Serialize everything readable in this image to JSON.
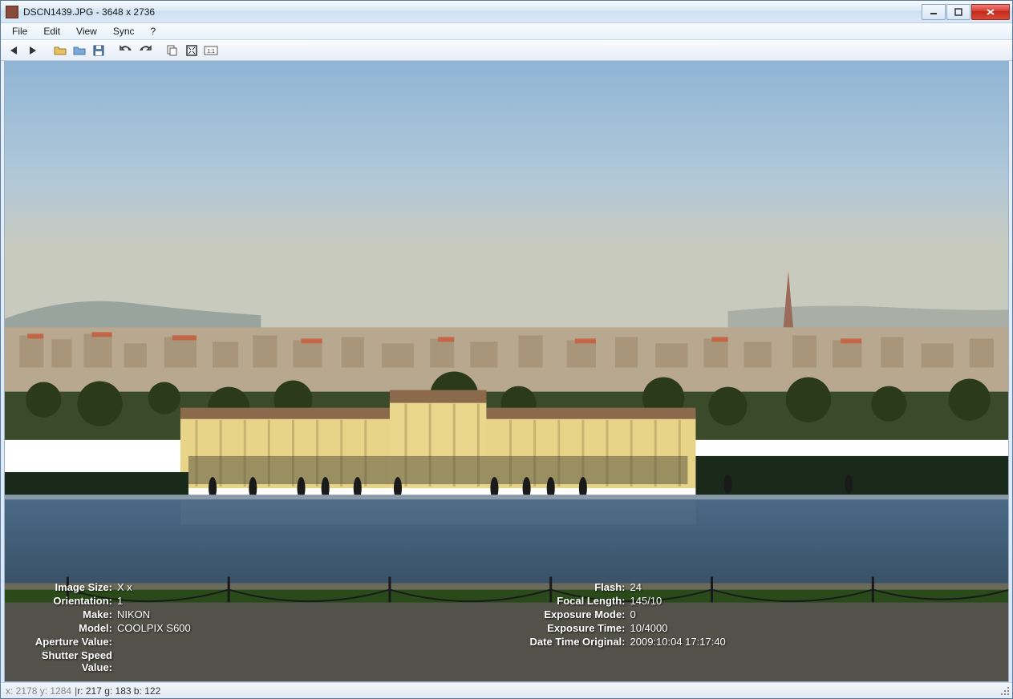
{
  "window": {
    "title": "DSCN1439.JPG - 3648 x 2736"
  },
  "menu": {
    "file": "File",
    "edit": "Edit",
    "view": "View",
    "sync": "Sync",
    "help": "?"
  },
  "toolbar": {
    "prev": "prev-image",
    "next": "next-image",
    "open": "open-file",
    "browse": "browse-folder",
    "save": "save",
    "undo": "undo",
    "redo": "redo",
    "copy": "copy",
    "fullscreen": "fullscreen",
    "onetoone": "actual-size"
  },
  "exif": {
    "left": [
      {
        "label": "Image Size:",
        "value": "X x"
      },
      {
        "label": "Orientation:",
        "value": "1"
      },
      {
        "label": "Make:",
        "value": "NIKON"
      },
      {
        "label": "Model:",
        "value": "COOLPIX S600"
      },
      {
        "label": "Aperture Value:",
        "value": ""
      },
      {
        "label": "Shutter Speed Value:",
        "value": ""
      }
    ],
    "right": [
      {
        "label": "Flash:",
        "value": "24"
      },
      {
        "label": "Focal Length:",
        "value": "145/10"
      },
      {
        "label": "Exposure Mode:",
        "value": "0"
      },
      {
        "label": "Exposure Time:",
        "value": "10/4000"
      },
      {
        "label": "Date Time Original:",
        "value": "2009:10:04 17:17:40"
      }
    ]
  },
  "status": {
    "coords": "x: 2178 y: 1284",
    "sep": " | ",
    "rgb": "r: 217 g: 183 b: 122"
  }
}
